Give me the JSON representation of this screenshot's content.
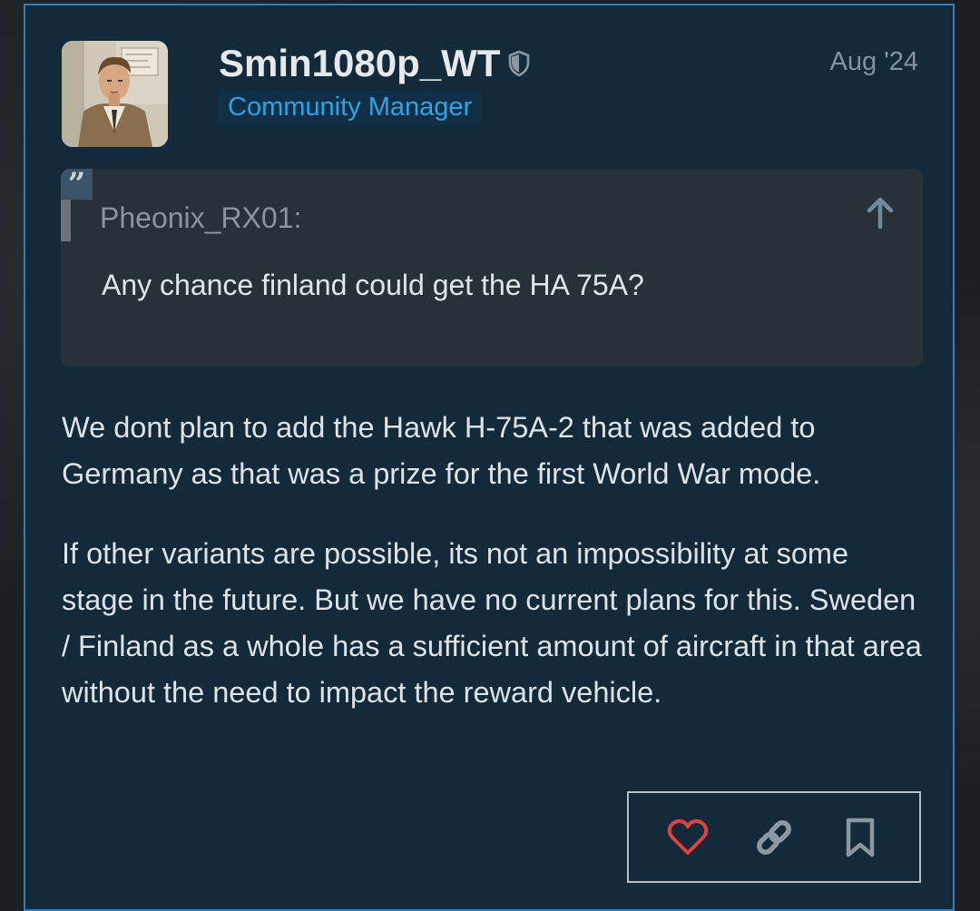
{
  "post": {
    "username": "Smin1080p_WT",
    "role": "Community Manager",
    "date": "Aug '24",
    "quote": {
      "author": "Pheonix_RX01:",
      "text": "Any chance finland could get the HA 75A?"
    },
    "paragraphs": [
      "We dont plan to add the Hawk H-75A-2 that was added to Germany as that was a prize for the first World War mode.",
      "If other variants are possible, its not an impossibility at some stage in the future. But we have no current plans for this. Sweden / Finland as a whole has a sufficient amount of aircraft in that area without the need to impact the reward vehicle."
    ],
    "actions": [
      {
        "icon": "heart-icon",
        "color": "#e0413a"
      },
      {
        "icon": "link-icon",
        "color": "#8a99a4"
      },
      {
        "icon": "bookmark-icon",
        "color": "#8a99a4"
      }
    ]
  },
  "colors": {
    "post_bg": "#132a3a",
    "post_border": "#2e7fbf",
    "role_color": "#2ea4e8",
    "quote_bg": "#273138"
  }
}
